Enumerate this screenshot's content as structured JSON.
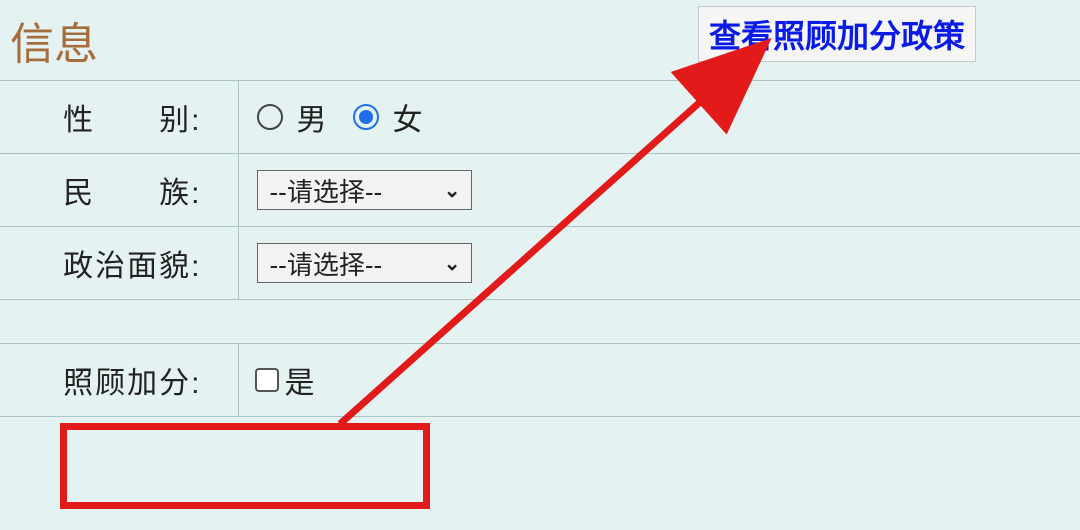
{
  "section_title": "信息",
  "policy_button": "查看照顾加分政策",
  "fields": {
    "gender": {
      "label": "性　　别:",
      "options": {
        "male": "男",
        "female": "女"
      },
      "selected": "female"
    },
    "ethnicity": {
      "label": "民　　族:",
      "placeholder": "--请选择--"
    },
    "political": {
      "label": "政治面貌:",
      "placeholder": "--请选择--"
    },
    "bonus": {
      "label": "照顾加分:",
      "option": "是",
      "checked": false
    }
  }
}
